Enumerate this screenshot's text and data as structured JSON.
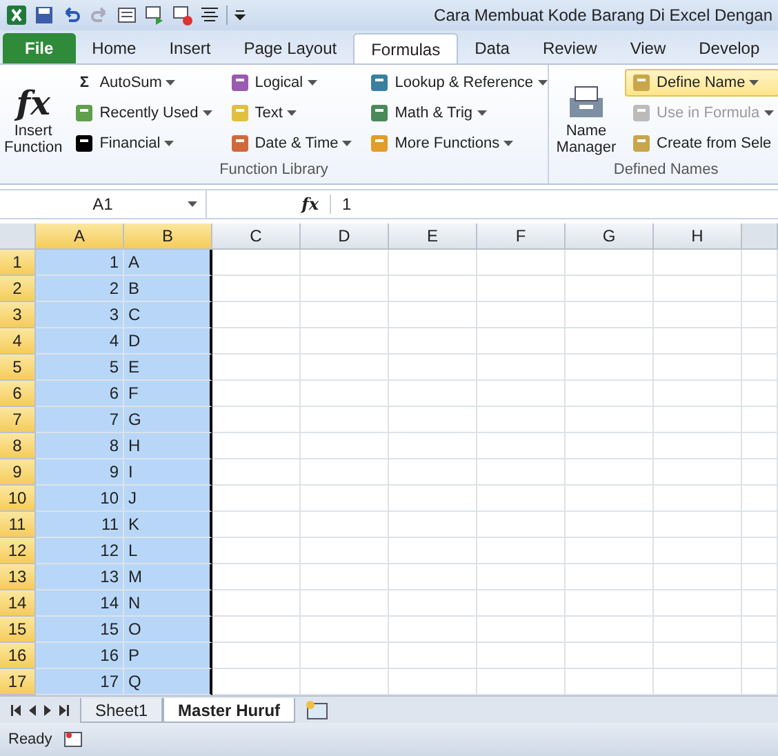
{
  "window": {
    "title": "Cara Membuat Kode Barang Di Excel Dengan"
  },
  "tabs": [
    {
      "label": "File",
      "kind": "file",
      "selected": false
    },
    {
      "label": "Home",
      "kind": "tab",
      "selected": false
    },
    {
      "label": "Insert",
      "kind": "tab",
      "selected": false
    },
    {
      "label": "Page Layout",
      "kind": "tab",
      "selected": false
    },
    {
      "label": "Formulas",
      "kind": "tab",
      "selected": true
    },
    {
      "label": "Data",
      "kind": "tab",
      "selected": false
    },
    {
      "label": "Review",
      "kind": "tab",
      "selected": false
    },
    {
      "label": "View",
      "kind": "tab",
      "selected": false
    },
    {
      "label": "Develop",
      "kind": "tab",
      "selected": false
    }
  ],
  "ribbon": {
    "insert_function": {
      "label": "Insert Function",
      "icon": "fx"
    },
    "function_library": {
      "label": "Function Library",
      "columns": [
        [
          {
            "label": "AutoSum",
            "icon": "Σ"
          },
          {
            "label": "Recently Used"
          },
          {
            "label": "Financial"
          }
        ],
        [
          {
            "label": "Logical"
          },
          {
            "label": "Text"
          },
          {
            "label": "Date & Time"
          }
        ],
        [
          {
            "label": "Lookup & Reference"
          },
          {
            "label": "Math & Trig"
          },
          {
            "label": "More Functions"
          }
        ]
      ]
    },
    "name_manager": {
      "label": "Name Manager"
    },
    "defined_names": {
      "label": "Defined Names",
      "items": [
        {
          "label": "Define Name",
          "highlighted": true,
          "disabled": false,
          "dropdown": true
        },
        {
          "label": "Use in Formula",
          "highlighted": false,
          "disabled": true,
          "dropdown": true
        },
        {
          "label": "Create from Sele",
          "highlighted": false,
          "disabled": false,
          "dropdown": false
        }
      ]
    }
  },
  "formula_bar": {
    "name_box": "A1",
    "fx": "fx",
    "value": "1"
  },
  "columns": [
    {
      "label": "A",
      "selected": true
    },
    {
      "label": "B",
      "selected": true
    },
    {
      "label": "C",
      "selected": false
    },
    {
      "label": "D",
      "selected": false
    },
    {
      "label": "E",
      "selected": false
    },
    {
      "label": "F",
      "selected": false
    },
    {
      "label": "G",
      "selected": false
    },
    {
      "label": "H",
      "selected": false
    }
  ],
  "rows": [
    {
      "number": "1",
      "a": "1",
      "b": "A",
      "selected": true
    },
    {
      "number": "2",
      "a": "2",
      "b": "B",
      "selected": true
    },
    {
      "number": "3",
      "a": "3",
      "b": "C",
      "selected": true
    },
    {
      "number": "4",
      "a": "4",
      "b": "D",
      "selected": true
    },
    {
      "number": "5",
      "a": "5",
      "b": "E",
      "selected": true
    },
    {
      "number": "6",
      "a": "6",
      "b": "F",
      "selected": true
    },
    {
      "number": "7",
      "a": "7",
      "b": "G",
      "selected": true
    },
    {
      "number": "8",
      "a": "8",
      "b": "H",
      "selected": true
    },
    {
      "number": "9",
      "a": "9",
      "b": "I",
      "selected": true
    },
    {
      "number": "10",
      "a": "10",
      "b": "J",
      "selected": true
    },
    {
      "number": "11",
      "a": "11",
      "b": "K",
      "selected": true
    },
    {
      "number": "12",
      "a": "12",
      "b": "L",
      "selected": true
    },
    {
      "number": "13",
      "a": "13",
      "b": "M",
      "selected": true
    },
    {
      "number": "14",
      "a": "14",
      "b": "N",
      "selected": true
    },
    {
      "number": "15",
      "a": "15",
      "b": "O",
      "selected": true
    },
    {
      "number": "16",
      "a": "16",
      "b": "P",
      "selected": true
    },
    {
      "number": "17",
      "a": "17",
      "b": "Q",
      "selected": true
    }
  ],
  "sheet_tabs": [
    {
      "label": "Sheet1",
      "selected": false
    },
    {
      "label": "Master Huruf",
      "selected": true
    }
  ],
  "status_bar": {
    "text": "Ready"
  }
}
